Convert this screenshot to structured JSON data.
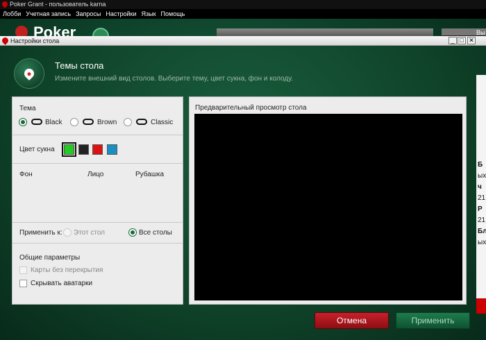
{
  "app": {
    "title": "Poker Grant - пользователь karna",
    "menu": [
      "Лобби",
      "Учетная запись",
      "Запросы",
      "Настройки",
      "Язык",
      "Помощь"
    ],
    "brand": "Poker",
    "right_fragments": [
      "Вы",
      "Б",
      "ых",
      "ч",
      "21",
      "Р",
      "21",
      "Бл",
      "ых"
    ]
  },
  "dialog": {
    "title": "Настройки стола",
    "win_buttons": {
      "minimize": "_",
      "maximize": "□",
      "close": "✕"
    },
    "header": {
      "title": "Темы стола",
      "subtitle": "Измените внешний вид столов. Выберите тему, цвет сукна, фон и колоду."
    },
    "theme": {
      "label": "Тема",
      "options": [
        {
          "label": "Black",
          "selected": true
        },
        {
          "label": "Brown",
          "selected": false
        },
        {
          "label": "Classic",
          "selected": false
        }
      ]
    },
    "cloth": {
      "label": "Цвет сукна",
      "colors": [
        "#22cc22",
        "#222222",
        "#dd1111",
        "#1a8fc2"
      ],
      "selected_index": 0
    },
    "columns": {
      "background": "Фон",
      "face": "Лицо",
      "back": "Рубашка"
    },
    "apply_to": {
      "label": "Применить к:",
      "options": [
        {
          "label": "Этот стол",
          "selected": false,
          "disabled": true
        },
        {
          "label": "Все столы",
          "selected": true,
          "disabled": false
        }
      ]
    },
    "general": {
      "label": "Общие параметры",
      "options": [
        {
          "label": "Карты без перекрытия",
          "checked": false,
          "disabled": true
        },
        {
          "label": "Скрывать аватарки",
          "checked": false,
          "disabled": false
        }
      ]
    },
    "preview": {
      "title": "Предварительный просмотр стола"
    },
    "buttons": {
      "cancel": "Отмена",
      "apply": "Применить"
    },
    "colors": {
      "cancel": "#b0151d",
      "apply": "#1a6b43",
      "accent": "#1a6b3a"
    }
  }
}
